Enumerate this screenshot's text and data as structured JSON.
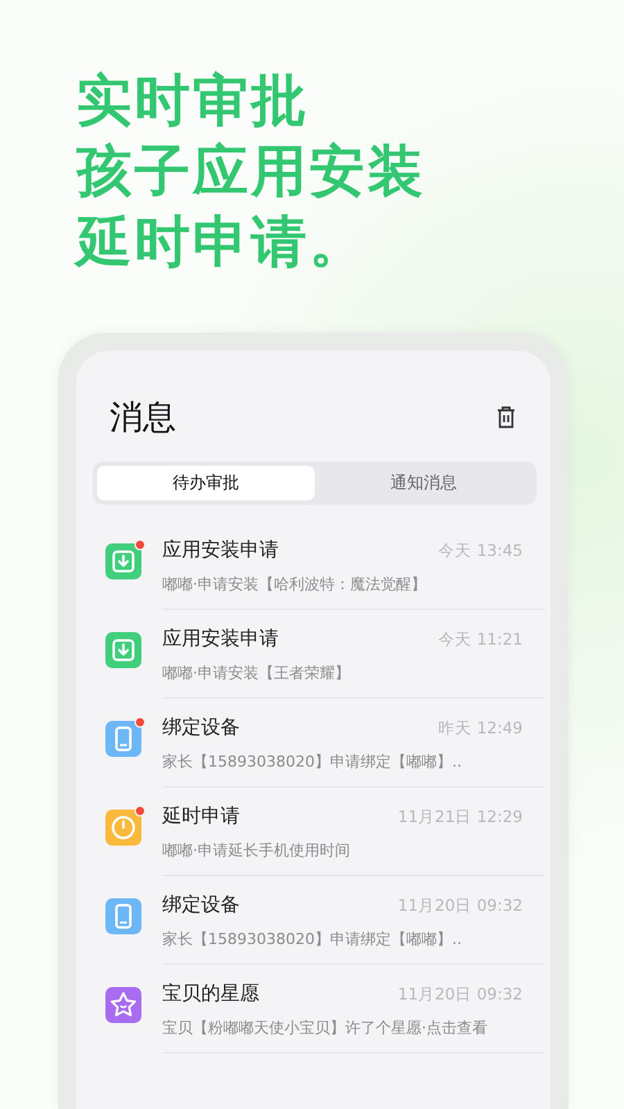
{
  "headline": [
    "实时审批",
    "孩子应用安装",
    "延时申请。"
  ],
  "screen": {
    "title": "消息",
    "tabs": [
      {
        "label": "待办审批",
        "selected": true
      },
      {
        "label": "通知消息",
        "selected": false
      }
    ],
    "messages": [
      {
        "kind": "install",
        "title": "应用安装申请",
        "time": "今天 13:45",
        "text": "嘟嘟·申请安装【哈利波特：魔法觉醒】",
        "unread": true
      },
      {
        "kind": "install",
        "title": "应用安装申请",
        "time": "今天 11:21",
        "text": "嘟嘟·申请安装【王者荣耀】",
        "unread": false
      },
      {
        "kind": "device",
        "title": "绑定设备",
        "time": "昨天 12:49",
        "text": "家长【15893038020】申请绑定【嘟嘟】..",
        "unread": true
      },
      {
        "kind": "timer",
        "title": "延时申请",
        "time": "11月21日 12:29",
        "text": "嘟嘟·申请延长手机使用时间",
        "unread": true
      },
      {
        "kind": "device",
        "title": "绑定设备",
        "time": "11月20日 09:32",
        "text": "家长【15893038020】申请绑定【嘟嘟】..",
        "unread": false
      },
      {
        "kind": "wish",
        "title": "宝贝的星愿",
        "time": "11月20日 09:32",
        "text": "宝贝【粉嘟嘟天使小宝贝】许了个星愿·点击查看",
        "unread": false
      }
    ]
  }
}
